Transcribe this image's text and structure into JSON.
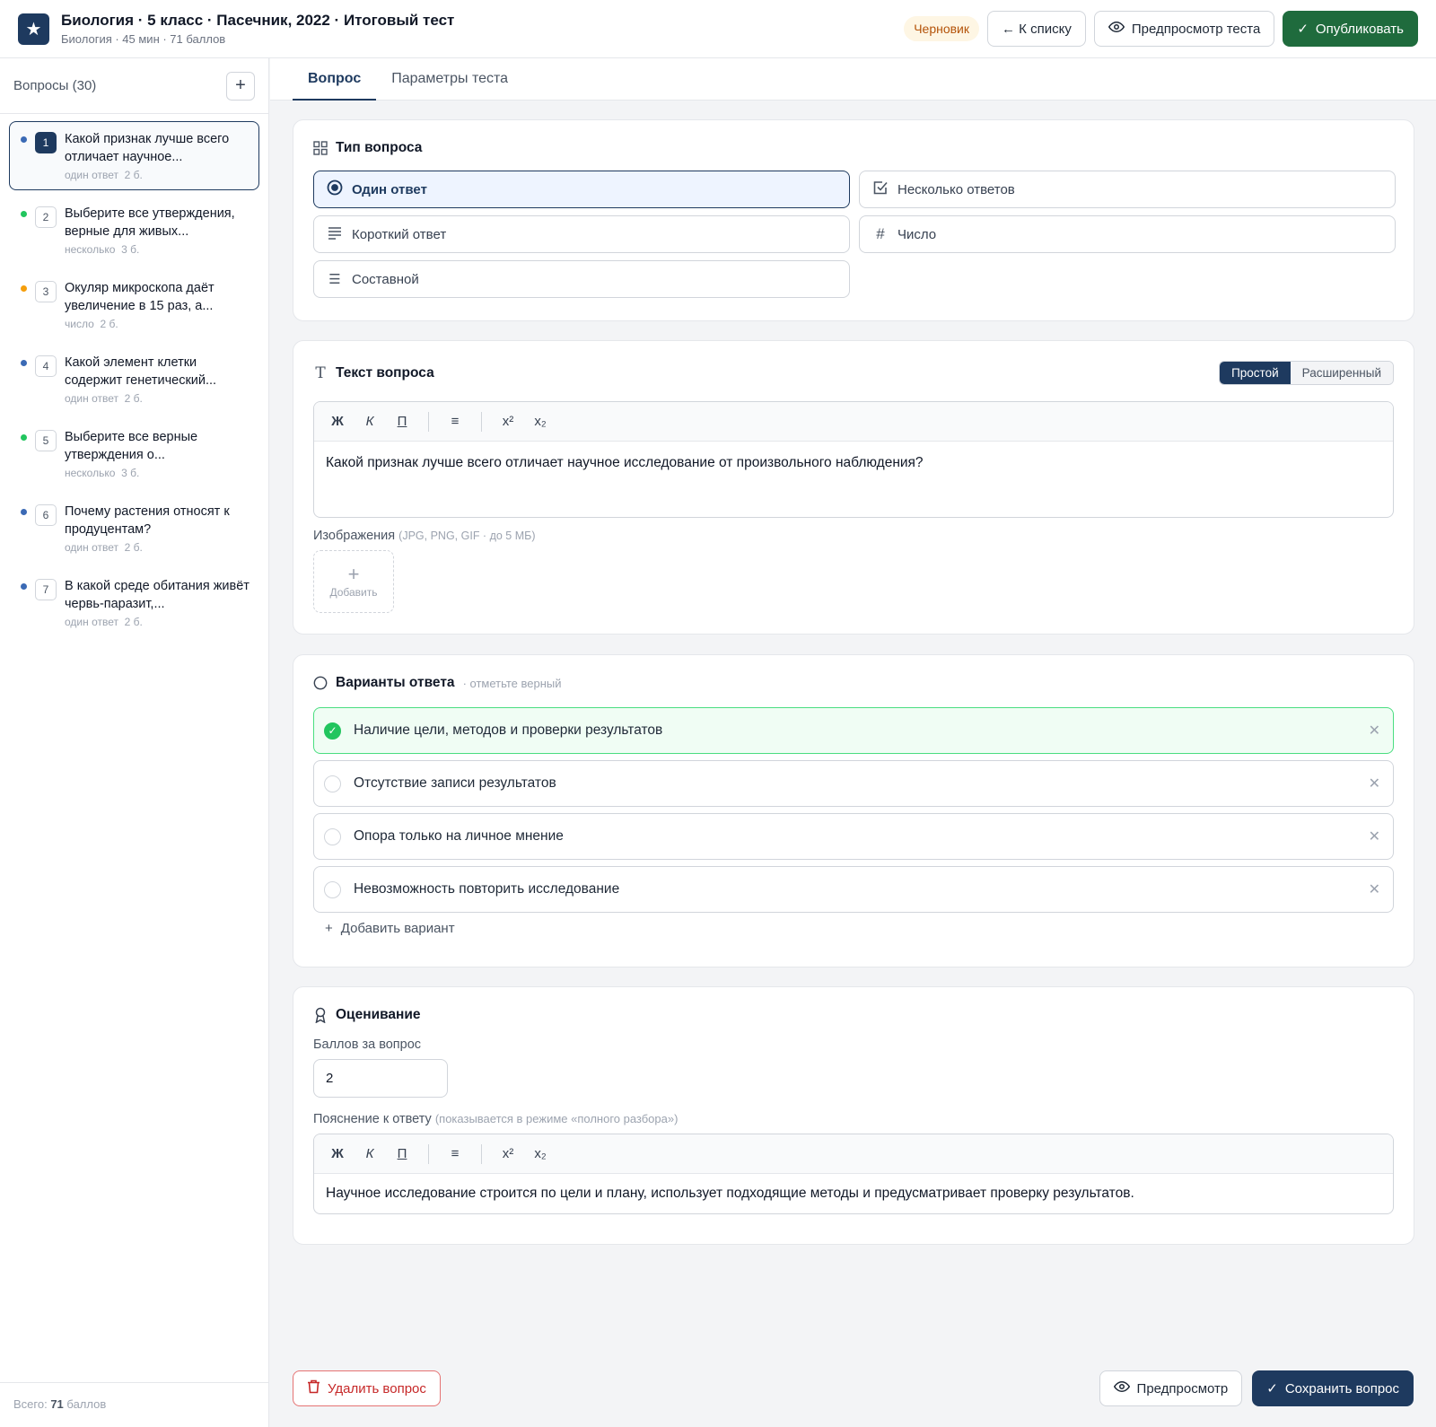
{
  "header": {
    "title": "Биология · 5 класс · Пасечник, 2022 · Итоговый тест",
    "subtitle": "Биология · 45 мин · 71 баллов",
    "status": "Черновик",
    "back_label": "← К списку",
    "preview_label": "Предпросмотр теста",
    "publish_label": "Опубликовать"
  },
  "sidebar": {
    "title": "Вопросы (30)",
    "footer_prefix": "Всего:",
    "footer_points": "71",
    "footer_suffix": "баллов",
    "items": [
      {
        "num": "1",
        "text": "Какой признак лучше всего отличает научное...",
        "type": "один ответ",
        "points": "2 б.",
        "dot": "#3b6ab5"
      },
      {
        "num": "2",
        "text": "Выберите все утверждения, верные для живых...",
        "type": "несколько",
        "points": "3 б.",
        "dot": "#22c55e"
      },
      {
        "num": "3",
        "text": "Окуляр микроскопа даёт увеличение в 15 раз, а...",
        "type": "число",
        "points": "2 б.",
        "dot": "#f59e0b"
      },
      {
        "num": "4",
        "text": "Какой элемент клетки содержит генетический...",
        "type": "один ответ",
        "points": "2 б.",
        "dot": "#3b6ab5"
      },
      {
        "num": "5",
        "text": "Выберите все верные утверждения о...",
        "type": "несколько",
        "points": "3 б.",
        "dot": "#22c55e"
      },
      {
        "num": "6",
        "text": "Почему растения относят к продуцентам?",
        "type": "один ответ",
        "points": "2 б.",
        "dot": "#3b6ab5"
      },
      {
        "num": "7",
        "text": "В какой среде обитания живёт червь-паразит,...",
        "type": "один ответ",
        "points": "2 б.",
        "dot": "#3b6ab5"
      }
    ]
  },
  "tabs": [
    "Вопрос",
    "Параметры теста"
  ],
  "question_type": {
    "title": "Тип вопроса",
    "options": [
      "Один ответ",
      "Несколько ответов",
      "Короткий ответ",
      "Число",
      "Составной"
    ]
  },
  "question_text": {
    "title": "Текст вопроса",
    "mode_simple": "Простой",
    "mode_advanced": "Расширенный",
    "toolbar": [
      "Ж",
      "К",
      "П",
      "≡",
      "x²",
      "x₂"
    ],
    "value": "Какой признак лучше всего отличает научное исследование от произвольного наблюдения?",
    "images_label": "Изображения",
    "images_hint": "(JPG, PNG, GIF · до 5 МБ)",
    "add_image": "Добавить"
  },
  "answers": {
    "title": "Варианты ответа",
    "hint": "· отметьте верный",
    "items": [
      {
        "text": "Наличие цели, методов и проверки результатов",
        "correct": true
      },
      {
        "text": "Отсутствие записи результатов",
        "correct": false
      },
      {
        "text": "Опора только на личное мнение",
        "correct": false
      },
      {
        "text": "Невозможность повторить исследование",
        "correct": false
      }
    ],
    "add_label": "Добавить вариант"
  },
  "grading": {
    "title": "Оценивание",
    "points_label": "Баллов за вопрос",
    "points_value": "2",
    "explanation_label": "Пояснение к ответу",
    "explanation_hint": "(показывается в режиме «полного разбора»)",
    "explanation_value": "Научное исследование строится по цели и плану, использует подходящие методы и предусматривает проверку результатов."
  },
  "footer": {
    "delete_label": "Удалить вопрос",
    "preview_label": "Предпросмотр",
    "save_label": "Сохранить вопрос"
  }
}
